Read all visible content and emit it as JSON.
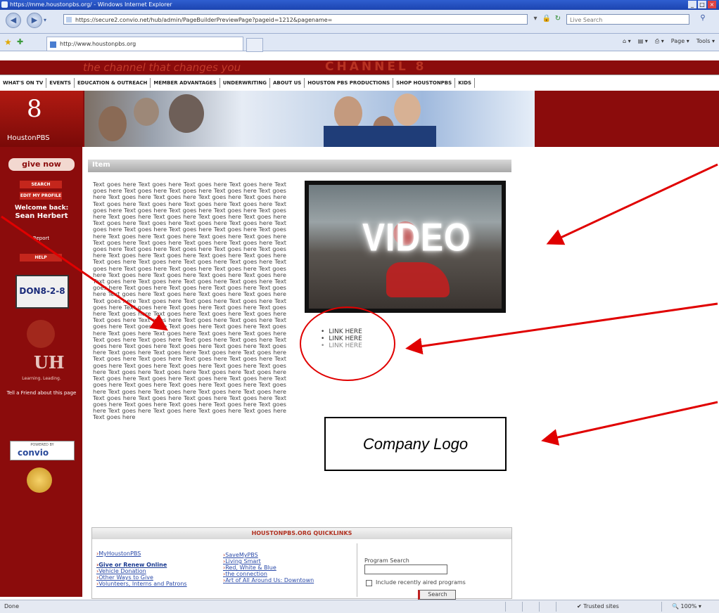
{
  "browser": {
    "title": "https://mme.houstonpbs.org/ - Windows Internet Explorer",
    "url": "https://secure2.convio.net/hub/admin/PageBuilderPreviewPage?pageid=1212&pagename=",
    "tab_title": "http://www.houstonpbs.org",
    "search_placeholder": "Live Search",
    "cmd_page": "Page",
    "cmd_tools": "Tools",
    "status_left": "Done",
    "status_zone": "Trusted sites",
    "status_zoom": "100%"
  },
  "site": {
    "tagline": "the channel that changes you",
    "channel": "CHANNEL 8",
    "nav": [
      "WHAT'S ON TV",
      "EVENTS",
      "EDUCATION & OUTREACH",
      "MEMBER ADVANTAGES",
      "UNDERWRITING",
      "ABOUT US",
      "HOUSTON PBS PRODUCTIONS",
      "SHOP HOUSTONPBS",
      "KIDS"
    ],
    "logo_mark": "8",
    "logo_text": "HoustonPBS"
  },
  "sidebar": {
    "give_now": "give now",
    "search": "SEARCH",
    "edit_profile": "EDIT MY PROFILE",
    "welcome": "Welcome back:",
    "user": "Sean Herbert",
    "report": "Report",
    "help": "HELP",
    "plate": "DON8-2-8",
    "uh_mark": "UH",
    "uh_text": "Learning. Leading.",
    "tell_friend": "Tell a Friend about this page",
    "powered_by": "POWERED BY",
    "convio": "convio"
  },
  "content": {
    "header": "Item",
    "body_text": "Text goes here Text goes here Text goes here Text goes here Text goes here Text goes here Text goes here Text goes here Text goes here Text goes here Text goes here Text goes here Text goes here Text goes here Text goes here Text goes here Text goes here Text goes here Text goes here Text goes here Text goes here Text goes here Text goes here Text goes here Text goes here Text goes here Text goes here Text goes here Text goes here Text goes here Text goes here Text goes here Text goes here Text goes here Text goes here Text goes here Text goes here Text goes here Text goes here Text goes here Text goes here Text goes here Text goes here Text goes here Text goes here Text goes here Text goes here Text goes here Text goes here Text goes here Text goes here Text goes here Text goes here Text goes here Text goes here Text goes here Text goes here Text goes here Text goes here Text goes here Text goes here Text goes here Text goes here Text goes here Text goes here Text goes here Text goes here Text goes here Text goes here Text goes here Text goes here Text goes here Text goes here Text goes here Text goes here Text goes here Text goes here Text goes here Text goes here Text goes here Text goes here Text goes here Text goes here Text goes here Text goes here Text goes here Text goes here Text goes here Text goes here Text goes here Text goes here Text goes here Text goes here Text goes here Text goes here Text goes here Text goes here Text goes here Text goes here Text goes here Text goes here Text goes here Text goes here Text goes here Text goes here Text goes here Text goes here Text goes here Text goes here Text goes here Text goes here Text goes here Text goes here Text goes here Text goes here Text goes here Text goes here Text goes here Text goes here Text goes here Text goes here Text goes here Text goes here Text goes here Text goes here Text goes here Text goes here Text goes here Text goes here Text goes here Text goes here Text goes here Text goes here Text goes here Text goes here Text goes here Text goes here Text goes here Text goes here Text goes here Text goes here Text goes here Text goes here Text goes here Text goes here Text goes here Text goes here Text goes here Text goes here Text goes here Text goes here Text goes here Text goes here Text goes here Text goes here Text goes here Text goes here",
    "video_label": "VIDEO",
    "links": [
      "LINK HERE",
      "LINK HERE",
      "LINK HERE"
    ],
    "company_logo": "Company Logo"
  },
  "quicklinks": {
    "header": "HOUSTONPBS.ORG QUICKLINKS",
    "col1": [
      "MyHoustonPBS",
      "Give or Renew Online",
      "Vehicle Donation",
      "Other Ways to Give",
      "Volunteers, Interns and Patrons"
    ],
    "col2": [
      "SaveMyPBS",
      "Living Smart",
      "Red, White & Blue",
      "the connection",
      "Art of All Around Us: Downtown"
    ],
    "search_label": "Program Search",
    "check_label": "Include recently aired programs",
    "search_button": "Search"
  },
  "colors": {
    "brand_red": "#8b0c0c",
    "annotation_red": "#e00000"
  }
}
